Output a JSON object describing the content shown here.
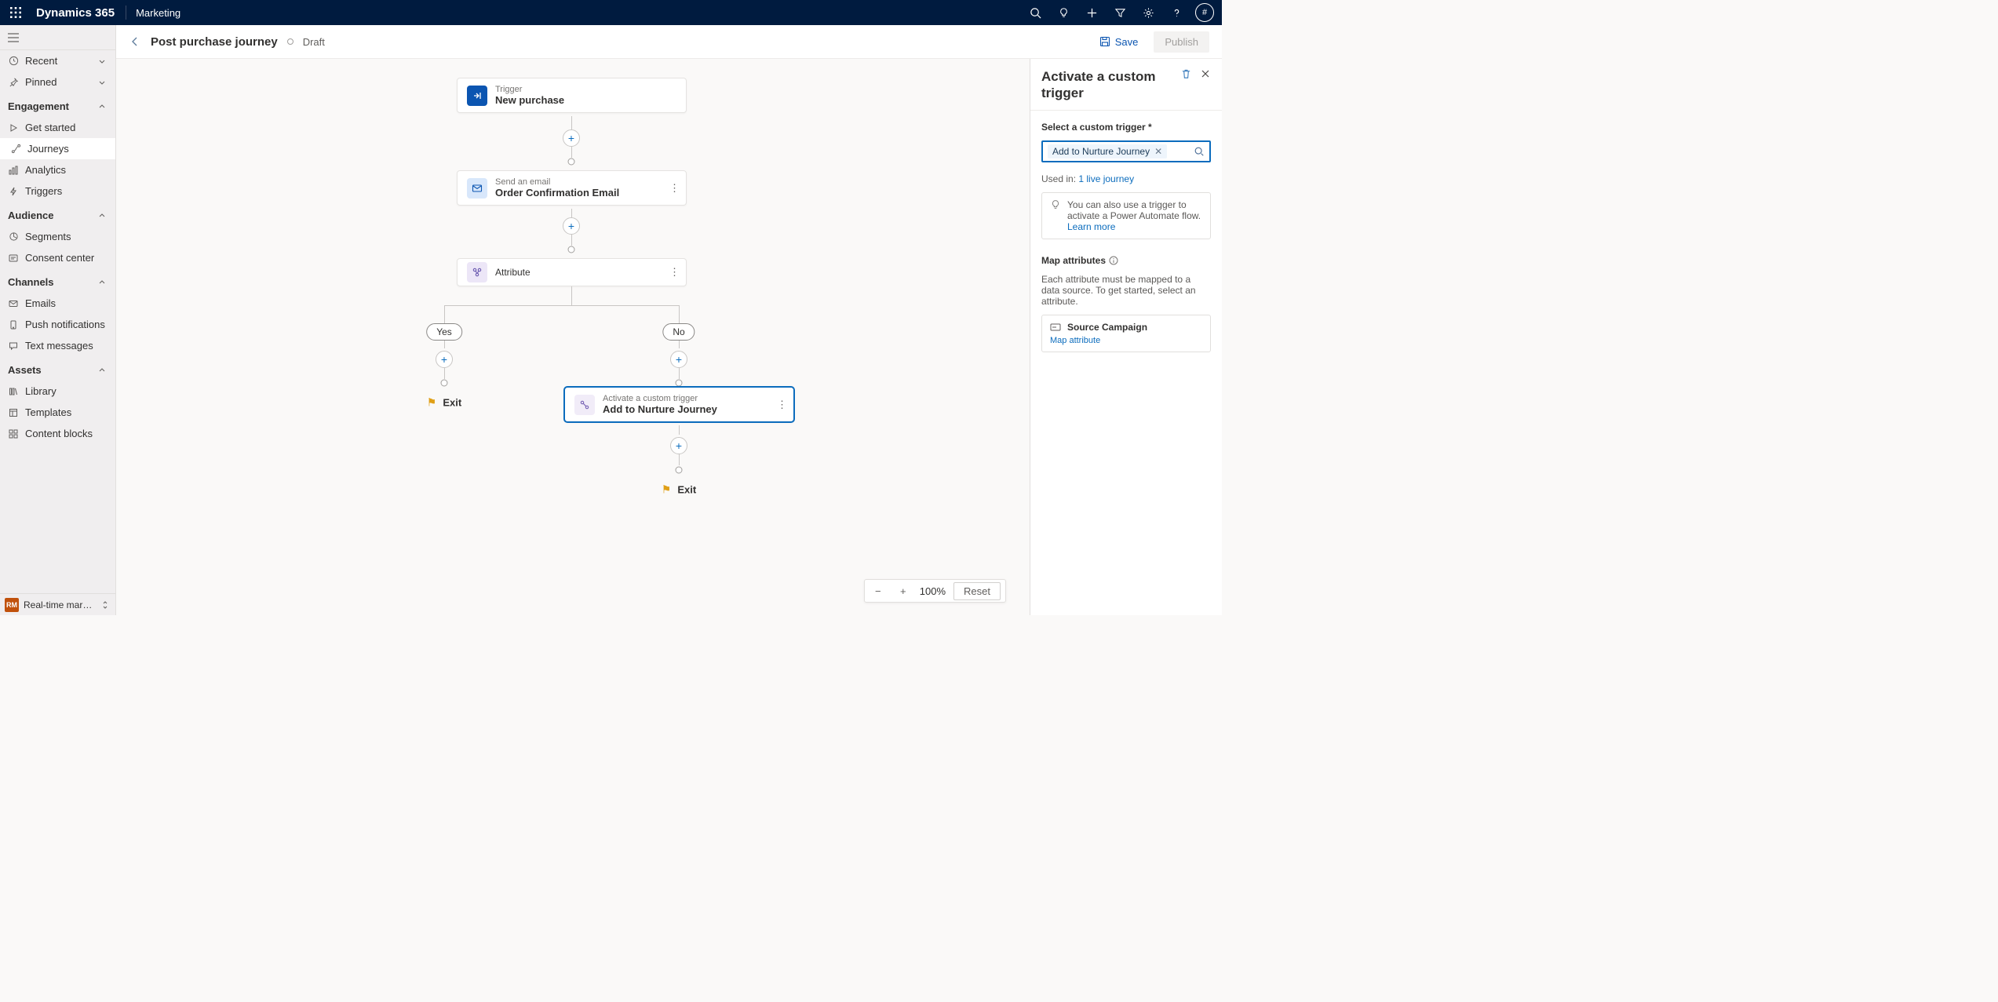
{
  "topbar": {
    "brand": "Dynamics 365",
    "area": "Marketing",
    "avatar": "#"
  },
  "sidebar": {
    "recent": "Recent",
    "pinned": "Pinned",
    "groups": {
      "engagement": "Engagement",
      "audience": "Audience",
      "channels": "Channels",
      "assets": "Assets"
    },
    "items": {
      "getStarted": "Get started",
      "journeys": "Journeys",
      "analytics": "Analytics",
      "triggers": "Triggers",
      "segments": "Segments",
      "consent": "Consent center",
      "emails": "Emails",
      "push": "Push notifications",
      "text": "Text messages",
      "library": "Library",
      "templates": "Templates",
      "content": "Content blocks"
    },
    "areaSwitch": {
      "abbr": "RM",
      "label": "Real-time marketi..."
    }
  },
  "cmdbar": {
    "title": "Post purchase journey",
    "status": "Draft",
    "save": "Save",
    "publish": "Publish"
  },
  "canvas": {
    "trigger": {
      "type": "Trigger",
      "name": "New purchase"
    },
    "email": {
      "type": "Send an email",
      "name": "Order Confirmation Email"
    },
    "attr": {
      "type": "Attribute"
    },
    "branchYes": "Yes",
    "branchNo": "No",
    "activate": {
      "type": "Activate a custom trigger",
      "name": "Add to Nurture Journey"
    },
    "exit": "Exit"
  },
  "zoom": {
    "level": "100%",
    "reset": "Reset"
  },
  "pane": {
    "title": "Activate a custom trigger",
    "selectLabel": "Select a custom trigger *",
    "selectedChip": "Add to Nurture Journey",
    "usedPrefix": "Used in: ",
    "usedLink": "1 live journey",
    "infoText": "You can also use a trigger to activate a Power Automate flow.",
    "learnMore": "Learn more",
    "mapTitle": "Map attributes",
    "mapDesc": "Each attribute must be mapped to a data source. To get started, select an attribute.",
    "attrName": "Source Campaign",
    "mapLink": "Map attribute"
  }
}
